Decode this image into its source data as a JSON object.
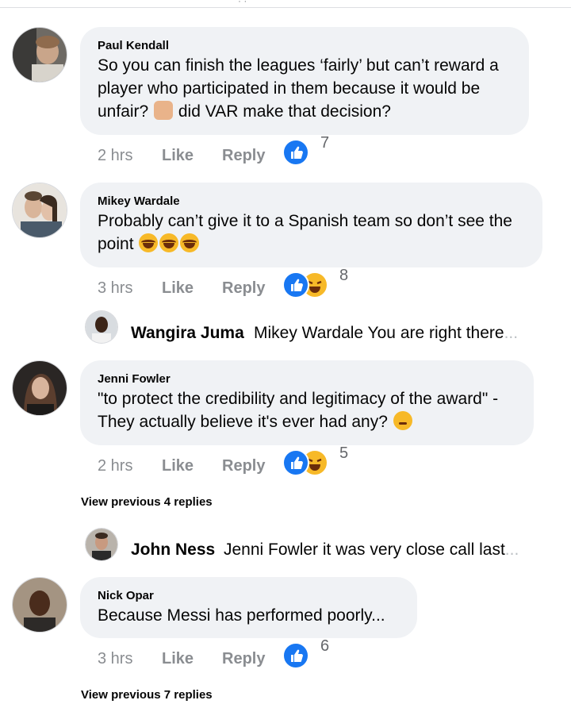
{
  "comments": [
    {
      "author": "Paul Kendall",
      "text_lines": [
        "So you can finish the leagues ‘fairly’ but can’t reward a",
        "player who participated in them because it would be",
        "unfair? ",
        " did VAR make that decision?"
      ],
      "time": "2 hrs",
      "like_label": "Like",
      "reply_label": "Reply",
      "reactions": [
        "like-icon"
      ],
      "reaction_count": "7",
      "avatar": "avatar-photo"
    },
    {
      "author": "Mikey Wardale",
      "text_lines": [
        "Probably can’t give it to a Spanish team so don’t see the",
        "point "
      ],
      "time": "3 hrs",
      "like_label": "Like",
      "reply_label": "Reply",
      "reactions": [
        "like-icon",
        "haha-icon"
      ],
      "reaction_count": "8",
      "avatar": "avatar-photo"
    },
    {
      "author": "Jenni Fowler",
      "text_lines": [
        "\"to protect the credibility and legitimacy of the award\" -",
        "They actually believe it's ever had any? "
      ],
      "time": "2 hrs",
      "like_label": "Like",
      "reply_label": "Reply",
      "reactions": [
        "like-icon",
        "haha-icon"
      ],
      "reaction_count": "5",
      "avatar": "avatar-photo"
    },
    {
      "author": "Nick Opar",
      "text_lines": [
        "Because Messi has performed poorly..."
      ],
      "time": "3 hrs",
      "like_label": "Like",
      "reply_label": "Reply",
      "reactions": [
        "like-icon"
      ],
      "reaction_count": "6",
      "avatar": "avatar-photo"
    }
  ],
  "replies": [
    {
      "author": "Wangira Juma",
      "text": "Mikey Wardale You are right there",
      "ellipsis": "..."
    },
    {
      "author": "John Ness",
      "text": "Jenni Fowler it was very close call last",
      "ellipsis": "..."
    }
  ],
  "view_previous": [
    "View previous 4 replies",
    "View previous 7 replies"
  ],
  "colors": {
    "bubble": "#f0f2f5",
    "like_blue": "#1877f2",
    "haha_yellow": "#f7b928",
    "meta_gray": "#8a8d91"
  }
}
